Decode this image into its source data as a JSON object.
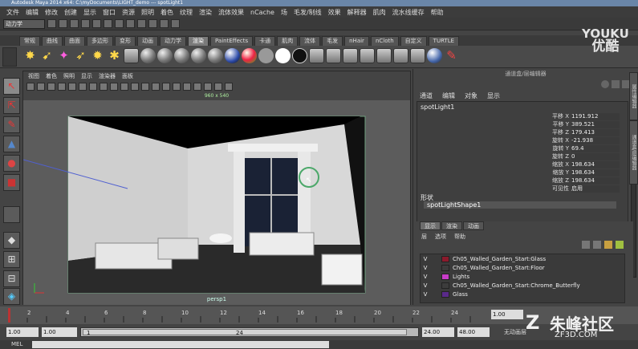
{
  "window": {
    "title": "Autodesk Maya 2014 x64: C:\\myDocuments\\LIGHT_demo  ---  spotLight1"
  },
  "menubar": [
    "文件",
    "编辑",
    "修改",
    "创建",
    "显示",
    "窗口",
    "资源",
    "照明",
    "着色",
    "纹理",
    "渲染",
    "流体效果",
    "nCache",
    "场",
    "毛发/制线",
    "效果",
    "解释器",
    "肌肉",
    "流水线缓存",
    "帮助"
  ],
  "status_line": {
    "mode": "动力学"
  },
  "shelf": {
    "tabs": [
      "常规",
      "曲线",
      "曲面",
      "多边形",
      "变形",
      "动画",
      "动力学",
      "渲染",
      "PaintEffects",
      "卡通",
      "肌肉",
      "流体",
      "毛发",
      "nHair",
      "nCloth",
      "自定义",
      "TURTLE"
    ],
    "active_tab": "渲染"
  },
  "viewport": {
    "menu": [
      "视图",
      "着色",
      "照明",
      "显示",
      "渲染器",
      "面板"
    ],
    "resolution": "960 x 540",
    "camera": "persp1"
  },
  "channel_box": {
    "title": "通道盒/层编辑器",
    "menu": [
      "通道",
      "编辑",
      "对象",
      "显示"
    ],
    "node": "spotLight1",
    "attributes": [
      {
        "label": "平移 X",
        "value": "1191.912"
      },
      {
        "label": "平移 Y",
        "value": "389.521"
      },
      {
        "label": "平移 Z",
        "value": "179.413"
      },
      {
        "label": "旋转 X",
        "value": "-21.938"
      },
      {
        "label": "旋转 Y",
        "value": "69.4"
      },
      {
        "label": "旋转 Z",
        "value": "0"
      },
      {
        "label": "缩放 X",
        "value": "198.634"
      },
      {
        "label": "缩放 Y",
        "value": "198.634"
      },
      {
        "label": "缩放 Z",
        "value": "198.634"
      },
      {
        "label": "可见性",
        "value": "启用"
      }
    ],
    "shapes_header": "形状",
    "shape_node": "spotLightShape1"
  },
  "layer_editor": {
    "tabs": [
      "显示",
      "渲染",
      "动画"
    ],
    "active_tab": "显示",
    "menu": [
      "层",
      "选项",
      "帮助"
    ],
    "layers": [
      {
        "vis": "V",
        "name": "Ch05_Walled_Garden_Start:Glass",
        "color": "#8b1a2c"
      },
      {
        "vis": "V",
        "name": "Ch05_Walled_Garden_Start:Floor",
        "color": "#3c3c3c"
      },
      {
        "vis": "V",
        "name": "Lights",
        "color": "#c83cc8"
      },
      {
        "vis": "V",
        "name": "Ch05_Walled_Garden_Start:Chrome_Butterfly",
        "color": "#3c3c3c"
      },
      {
        "vis": "V",
        "name": "Glass",
        "color": "#5a2a8a"
      }
    ]
  },
  "side_tabs": [
    "属性编辑器",
    "通道盒/层编辑器"
  ],
  "time_slider": {
    "ticks": [
      "2",
      "4",
      "6",
      "8",
      "10",
      "12",
      "14",
      "16",
      "18",
      "20",
      "22",
      "24"
    ],
    "current": "1.00"
  },
  "range": {
    "start": "1.00",
    "anim_start": "1.00",
    "range_start": "1",
    "range_end": "24",
    "anim_end_a": "24.00",
    "anim_end_b": "48.00",
    "char_set": "无动画层"
  },
  "command_line": {
    "label": "MEL"
  },
  "watermarks": {
    "youku_brand": "YOUKU",
    "youku_cn": "优酷",
    "site_cn": "朱峰社区",
    "site_url": "ZF3D.COM"
  }
}
